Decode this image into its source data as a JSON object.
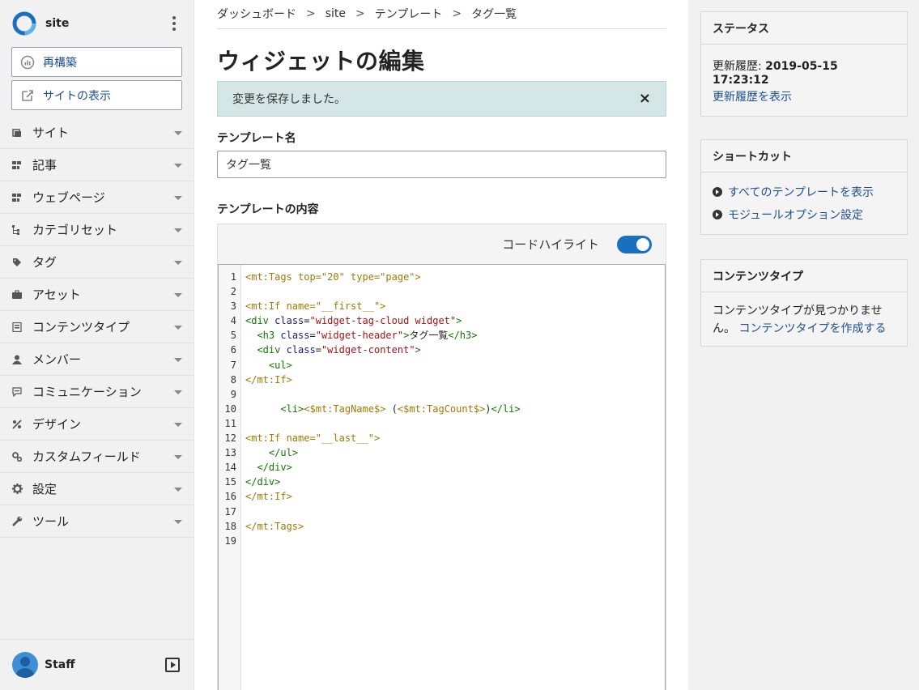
{
  "sidebar": {
    "site_name": "site",
    "buttons": [
      {
        "label": "再構築",
        "icon": "rebuild-icon"
      },
      {
        "label": "サイトの表示",
        "icon": "external-view-icon"
      }
    ],
    "nav": [
      {
        "label": "サイト",
        "icon": "site-icon"
      },
      {
        "label": "記事",
        "icon": "entry-icon"
      },
      {
        "label": "ウェブページ",
        "icon": "page-icon"
      },
      {
        "label": "カテゴリセット",
        "icon": "category-set-icon"
      },
      {
        "label": "タグ",
        "icon": "tag-icon"
      },
      {
        "label": "アセット",
        "icon": "asset-icon"
      },
      {
        "label": "コンテンツタイプ",
        "icon": "content-type-icon"
      },
      {
        "label": "メンバー",
        "icon": "member-icon"
      },
      {
        "label": "コミュニケーション",
        "icon": "communication-icon"
      },
      {
        "label": "デザイン",
        "icon": "design-icon"
      },
      {
        "label": "カスタムフィールド",
        "icon": "custom-field-icon"
      },
      {
        "label": "設定",
        "icon": "gear-icon"
      },
      {
        "label": "ツール",
        "icon": "wrench-icon"
      }
    ],
    "user_name": "Staff"
  },
  "breadcrumb": [
    "ダッシュボード",
    "site",
    "テンプレート",
    "タグ一覧"
  ],
  "breadcrumb_sep": ">",
  "page_title": "ウィジェットの編集",
  "alert": {
    "message": "変更を保存しました。",
    "close": "×"
  },
  "template_name": {
    "label": "テンプレート名",
    "value": "タグ一覧"
  },
  "template_content": {
    "label": "テンプレートの内容",
    "highlight_label": "コードハイライト",
    "highlight_on": true,
    "line_numbers": [
      "1",
      "2",
      "3",
      "4",
      "5",
      "6",
      "7",
      "8",
      "9",
      "10",
      "11",
      "12",
      "13",
      "14",
      "15",
      "16",
      "17",
      "18",
      "19"
    ],
    "lines": [
      "<mt:Tags top=\"20\" type=\"page\">",
      "",
      "<mt:If name=\"__first__\">",
      "<div class=\"widget-tag-cloud widget\">",
      "  <h3 class=\"widget-header\">タグ一覧</h3>",
      "  <div class=\"widget-content\">",
      "    <ul>",
      "</mt:If>",
      "",
      "      <li><$mt:TagName$> (<$mt:TagCount$>)</li>",
      "",
      "<mt:If name=\"__last__\">",
      "    </ul>",
      "  </div>",
      "</div>",
      "</mt:If>",
      "",
      "</mt:Tags>",
      ""
    ]
  },
  "status_panel": {
    "title": "ステータス",
    "updated_label": "更新履歴:",
    "updated_value": "2019-05-15 17:23:12",
    "history_link": "更新履歴を表示"
  },
  "shortcut_panel": {
    "title": "ショートカット",
    "links": [
      "すべてのテンプレートを表示",
      "モジュールオプション設定"
    ]
  },
  "content_type_panel": {
    "title": "コンテンツタイプ",
    "text": "コンテンツタイプが見つかりません。",
    "link": "コンテンツタイプを作成する"
  },
  "colors": {
    "accent": "#1a6fbf",
    "link": "#1d4f91",
    "alert_bg": "#d4e7e6",
    "mt_tag": "#a17900",
    "html_tag": "#117700"
  }
}
